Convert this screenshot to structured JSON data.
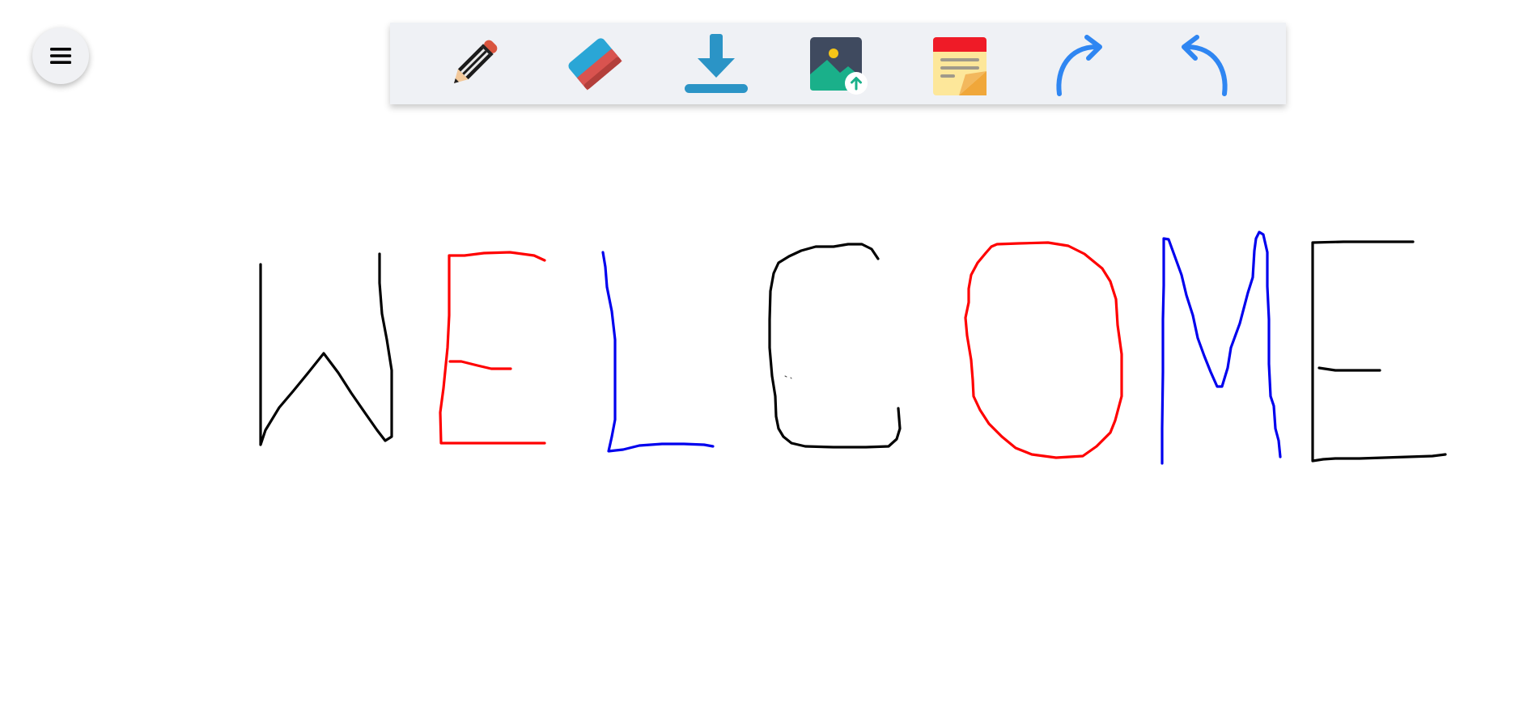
{
  "menu": {
    "icon": "hamburger-menu-icon"
  },
  "toolbar": {
    "tools": [
      {
        "id": "pencil",
        "icon": "pencil-icon"
      },
      {
        "id": "eraser",
        "icon": "eraser-icon"
      },
      {
        "id": "download",
        "icon": "download-icon"
      },
      {
        "id": "upload-image",
        "icon": "image-upload-icon"
      },
      {
        "id": "sticky-note",
        "icon": "sticky-note-icon"
      },
      {
        "id": "redo",
        "icon": "redo-arrow-icon"
      },
      {
        "id": "undo",
        "icon": "undo-arrow-icon"
      }
    ]
  },
  "colors": {
    "black_stroke": "#000000",
    "red_stroke": "#ff0000",
    "blue_stroke": "#0000ee",
    "toolbar_bg": "#eff1f5",
    "arrow_blue": "#2f86f2"
  },
  "drawing": {
    "strokes": [
      {
        "letter": "W",
        "color": "black"
      },
      {
        "letter": "E",
        "color": "red"
      },
      {
        "letter": "L",
        "color": "blue"
      },
      {
        "letter": "C",
        "color": "black"
      },
      {
        "letter": "O",
        "color": "red"
      },
      {
        "letter": "M",
        "color": "blue"
      },
      {
        "letter": "E",
        "color": "black"
      }
    ]
  }
}
